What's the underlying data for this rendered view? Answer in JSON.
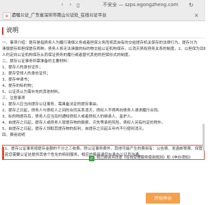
{
  "browser": {
    "address": "不安全 — szps.egongzheng.com",
    "tab_title": "遗嘱公证_广东省深圳市南山公证处_在线公证平台",
    "back_icon": "chevron-left-icon",
    "forward_icon": "chevron-right-icon",
    "reload_icon": "reload-icon"
  },
  "document": {
    "title": "说明",
    "lines": [
      "一、事项介绍：提存是指债务人为履行清偿义务或者担保义务而将其自有的交给提存机关保存的法律行为。提存分为",
      "清偿提存和担保提存两种。债务人将无法清偿的标的物交给公证机构保存，以消灭债权债务关系的制度。2、以担保为目的的提存（简称\"担",
      "人约定向公证机构保存从而保证债务的履行或者替代其他的担保形式的制度。",
      "二、提存公证事务所需准备的主要材料：",
      "1、提存人的身份证件；",
      "2、提存受领人的身份证件；",
      "3、提存申请书；",
      "4、提存的标的物；",
      "5、公证员认为需补充的其他材料。",
      "三、注意事项",
      "1、提存人应当向提存公证事务、需具备法定的提存事由。",
      "2、提存之日起，债务人与债权人之间的合同关系消灭，债权人不得再向债务人请求履行合同。",
      "3、标的物提存后，债务人应当及时通知债权人或者债权人的继承人、监护人。",
      "4、自提存之日起，提存人或债务人就提存物的毁损、灭失等承担风险，债权人另有约定的除外。",
      "5、自提存之日起，提存人领取其提存物的权利，自提存之日起五年内不行使则消灭。",
      "四、费用说明"
    ],
    "highlight_lines": [
      "1、提存公证事务按提存金额的千分之三收费。除公证事务费外，其他可能产生的费用有：公告费、发函邮寄费、保管费等具体费用",
      "若您需要公证处提供其他个性化的特别服务，相应的费用请您与承办公证员沟通。"
    ]
  },
  "agreement": {
    "checked": true,
    "text": "我已阅读并同意",
    "link1": "《在线受理服务使用规则》",
    "link2": "《申办须知》",
    "tail": "和"
  },
  "actions": {
    "start_label": "开始申办"
  },
  "colors": {
    "accent": "#c0392b",
    "highlight_border": "#e04a2f",
    "button": "#f5a04a",
    "checkbox": "#4caf50"
  }
}
